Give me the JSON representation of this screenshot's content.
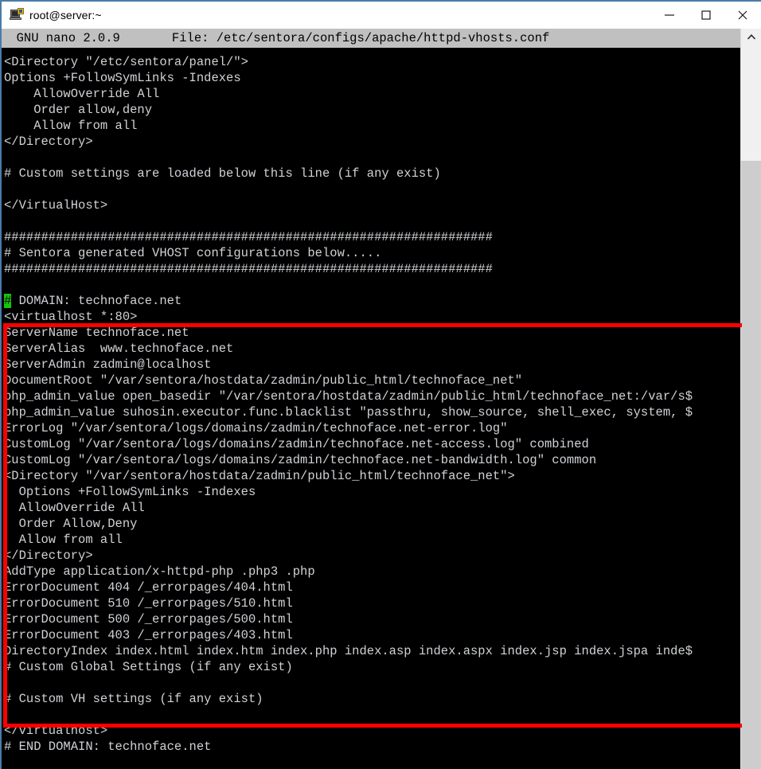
{
  "window": {
    "title": "root@server:~",
    "icon": "putty-terminal-icon",
    "controls": {
      "minimize": "minimize-icon",
      "maximize": "maximize-icon",
      "close": "close-icon"
    }
  },
  "editor": {
    "name": "GNU nano",
    "version": "2.0.9",
    "header": "  GNU nano 2.0.9       File: /etc/sentora/configs/apache/httpd-vhosts.conf",
    "file_label": "File:",
    "file_path": "/etc/sentora/configs/apache/httpd-vhosts.conf"
  },
  "cursor": {
    "character": "#",
    "line_index": 15,
    "column": 0,
    "background_color": "#16c60c",
    "foreground_color": "#0a0a0a"
  },
  "colors": {
    "terminal_background": "#000000",
    "terminal_foreground": "#cfd2d6",
    "header_background": "#c0c0c0",
    "header_foreground": "#000000",
    "annotation_red": "#ff0000",
    "window_border": "#4a7ca8",
    "scrollbar_track": "#f0f0f0",
    "scrollbar_thumb": "#cdcdcd"
  },
  "annotation": {
    "shape": "rectangle",
    "color": "#ff0000",
    "label": "highlighted-vhost-block"
  },
  "scrollbar": {
    "up_arrow": "chevron-up-icon",
    "thumb_position": "lower"
  },
  "terminal_lines": [
    "<Directory \"/etc/sentora/panel/\">",
    "Options +FollowSymLinks -Indexes",
    "    AllowOverride All",
    "    Order allow,deny",
    "    Allow from all",
    "</Directory>",
    "",
    "# Custom settings are loaded below this line (if any exist)",
    "",
    "</VirtualHost>",
    "",
    "##################################################################",
    "# Sentora generated VHOST configurations below.....",
    "##################################################################",
    "",
    "# DOMAIN: technoface.net",
    "<virtualhost *:80>",
    "ServerName technoface.net",
    "ServerAlias  www.technoface.net",
    "ServerAdmin zadmin@localhost",
    "DocumentRoot \"/var/sentora/hostdata/zadmin/public_html/technoface_net\"",
    "php_admin_value open_basedir \"/var/sentora/hostdata/zadmin/public_html/technoface_net:/var/s$",
    "php_admin_value suhosin.executor.func.blacklist \"passthru, show_source, shell_exec, system, $",
    "ErrorLog \"/var/sentora/logs/domains/zadmin/technoface.net-error.log\"",
    "CustomLog \"/var/sentora/logs/domains/zadmin/technoface.net-access.log\" combined",
    "CustomLog \"/var/sentora/logs/domains/zadmin/technoface.net-bandwidth.log\" common",
    "<Directory \"/var/sentora/hostdata/zadmin/public_html/technoface_net\">",
    "  Options +FollowSymLinks -Indexes",
    "  AllowOverride All",
    "  Order Allow,Deny",
    "  Allow from all",
    "</Directory>",
    "AddType application/x-httpd-php .php3 .php",
    "ErrorDocument 404 /_errorpages/404.html",
    "ErrorDocument 510 /_errorpages/510.html",
    "ErrorDocument 500 /_errorpages/500.html",
    "ErrorDocument 403 /_errorpages/403.html",
    "DirectoryIndex index.html index.htm index.php index.asp index.aspx index.jsp index.jspa inde$",
    "# Custom Global Settings (if any exist)",
    "",
    "# Custom VH settings (if any exist)",
    "",
    "</virtualhost>",
    "# END DOMAIN: technoface.net"
  ]
}
